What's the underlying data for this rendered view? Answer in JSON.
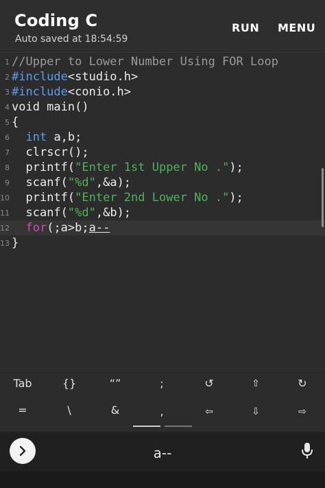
{
  "app": {
    "title": "Coding C",
    "subtitle": "Auto saved at 18:54:59",
    "run_label": "RUN",
    "menu_label": "MENU"
  },
  "editor": {
    "lines": [
      {
        "n": "1",
        "t1": "//Upper to Lower Number Using FOR Loop"
      },
      {
        "n": "2",
        "t1": "#include",
        "t2": "<studio.h>"
      },
      {
        "n": "3",
        "t1": "#include",
        "t2": "<conio.h>"
      },
      {
        "n": "4",
        "t1": "void main()"
      },
      {
        "n": "5",
        "t1": "{"
      },
      {
        "n": "6",
        "t1": "int",
        "t2": " a,b;"
      },
      {
        "n": "7",
        "t1": "clrscr();"
      },
      {
        "n": "8",
        "t1": "printf(",
        "t2": "\"Enter 1st Upper No .\"",
        "t3": ");"
      },
      {
        "n": "9",
        "t1": "scanf(",
        "t2": "\"%d\"",
        "t3": ",&a);"
      },
      {
        "n": "10",
        "t1": "printf(",
        "t2": "\"Enter 2nd Lower No .\"",
        "t3": ");"
      },
      {
        "n": "11",
        "t1": "scanf(",
        "t2": "\"%d\"",
        "t3": ",&b);"
      },
      {
        "n": "12",
        "t1": "for",
        "t2": "(;a>b;",
        "t3": "a--"
      },
      {
        "n": "13",
        "t1": "}"
      }
    ]
  },
  "toolbar": {
    "row1": [
      "Tab",
      "{}",
      "“”",
      ";",
      "↺",
      "⇧",
      "↻"
    ],
    "row2": [
      "=",
      "\\",
      "&",
      ",",
      "⇦",
      "⇩",
      "⇨"
    ]
  },
  "keyboard": {
    "suggestion": "a--"
  },
  "colors": {
    "keyword": "#5a9cf0",
    "string": "#4fb35a",
    "for_keyword": "#d44ab0",
    "comment": "#9a9a9a"
  }
}
